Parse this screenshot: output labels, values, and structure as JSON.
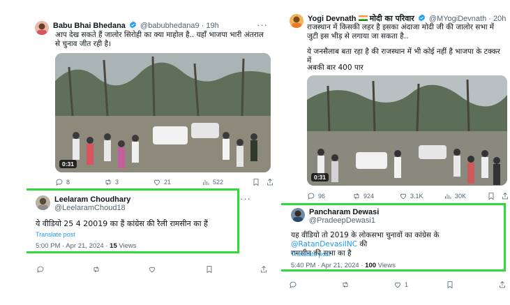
{
  "left": {
    "tweet": {
      "name": "Babu Bhai Bhedana",
      "handle": "@babubhedana9",
      "time": "· 19h",
      "text": "आप देख सकते हैं जालोर सिरोही का क्या माहोल है.. यहाँ भाजपा भारी अंतराल से चुनाव जीत रही है।",
      "duration": "0:31",
      "actions": {
        "replies": "8",
        "reposts": "3",
        "likes": "21",
        "views": "522"
      }
    },
    "reply": {
      "name": "Leelaram Choudhary",
      "handle": "@LeelaramChoud18",
      "text": "ये वीडियो 25  4  20019  का हैं कांग्रेस की रैली रामसीन का हैं",
      "translate": "Translate post",
      "timestamp": "5:00 PM · Apr 21, 2024 · ",
      "views_count": "15",
      "views_label": " Views"
    }
  },
  "right": {
    "tweet": {
      "name": "Yogi Devnath",
      "name_suffix": "मोदी का परिवार",
      "handle": "@MYogiDevnath",
      "time": "· 20h",
      "text_1": "राजस्थान में किसकी लहर है इसका अंदाजा मोदी जी की जालोर सभा में जुटी इस भीड़ से लगाया जा सकता है..",
      "text_2": "ये जनसैलाब बता रहा है की राजस्थान में भी कोई नहीं है भाजपा के टक्कर में",
      "text_3": "अबकी बार 400 पार",
      "duration": "0:31",
      "actions": {
        "replies": "96",
        "reposts": "924",
        "likes": "3.1K",
        "views": "30K"
      }
    },
    "reply": {
      "name": "Pancharam Dewasi",
      "handle": "@PradeepDewasi1",
      "text": "यह वीडियो तो 2019 के लोकसभा चुनावों का कांग्रेस के ",
      "mention": "@RatanDevasiINC",
      "text_end": " की",
      "text_line2": "रामसीन की सभा का है",
      "translate": "Translate post",
      "timestamp": "5:40 PM · Apr 21, 2024 · ",
      "views_count": "100",
      "views_label": " Views",
      "likes": "1"
    }
  },
  "colors": {
    "highlight": "#32d93a",
    "link": "#1d9bf0",
    "verified": "#1d9bf0",
    "muted": "#536471"
  }
}
